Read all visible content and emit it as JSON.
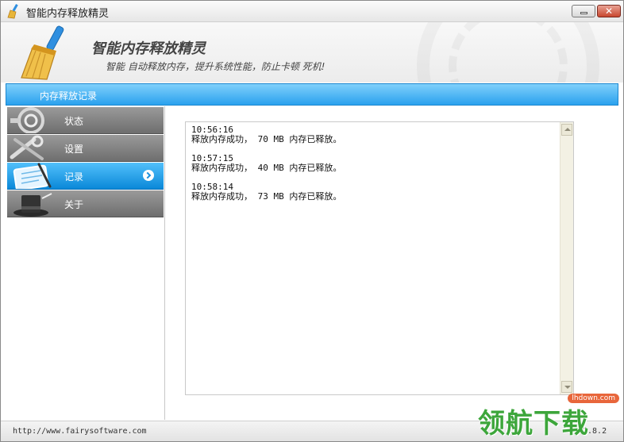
{
  "window": {
    "title": "智能内存释放精灵"
  },
  "header": {
    "app_name": "智能内存释放精灵",
    "slogan": "智能 自动释放内存，提升系统性能，防止卡顿 死机!"
  },
  "section": {
    "title": "内存释放记录"
  },
  "sidebar": {
    "items": [
      {
        "label": "状态",
        "icon": "gauge-icon",
        "active": false
      },
      {
        "label": "设置",
        "icon": "tools-icon",
        "active": false
      },
      {
        "label": "记录",
        "icon": "notebook-icon",
        "active": true
      },
      {
        "label": "关于",
        "icon": "magic-hat-icon",
        "active": false
      }
    ]
  },
  "log": {
    "entries": [
      {
        "time": "10:56:16",
        "message": "释放内存成功， 70 MB 内存已释放。"
      },
      {
        "time": "10:57:15",
        "message": "释放内存成功， 40 MB 内存已释放。"
      },
      {
        "time": "10:58:14",
        "message": "释放内存成功， 73 MB 内存已释放。"
      }
    ]
  },
  "status": {
    "url": "http://www.fairysoftware.com",
    "version": "3.8.2"
  },
  "watermark": {
    "site": "lhdown.com",
    "text": "领航下载"
  },
  "colors": {
    "accent": "#2aa1ee",
    "nav_inactive": "#7a7a7a",
    "close_button": "#c8462e"
  }
}
